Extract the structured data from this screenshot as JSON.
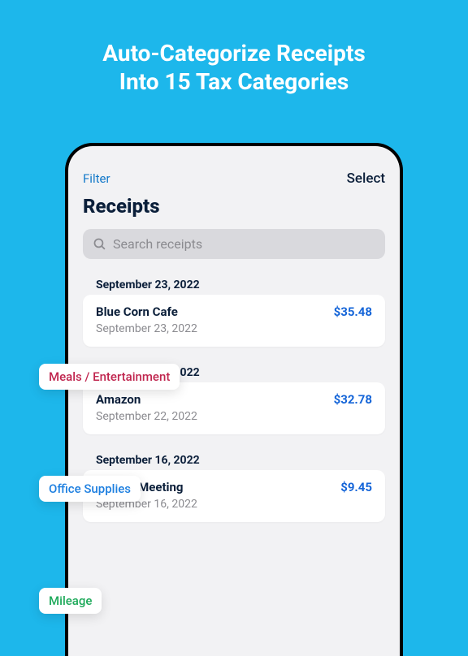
{
  "headline_line1": "Auto-Categorize Receipts",
  "headline_line2": "Into 15 Tax Categories",
  "topbar": {
    "filter": "Filter",
    "select": "Select"
  },
  "page_title": "Receipts",
  "search": {
    "placeholder": "Search receipts"
  },
  "sections": [
    {
      "date_header": "September 23, 2022",
      "card": {
        "merchant": "Blue Corn Cafe",
        "date": "September 23, 2022",
        "amount": "$35.48"
      },
      "tag": {
        "label": "Meals / Entertainment",
        "color": "meals"
      }
    },
    {
      "date_header": "September 22, 2022",
      "card": {
        "merchant": "Amazon",
        "date": "September 22, 2022",
        "amount": "$32.78"
      },
      "tag": {
        "label": "Office Supplies",
        "color": "office"
      }
    },
    {
      "date_header": "September 16, 2022",
      "card": {
        "merchant": "Vendor Meeting",
        "date": "September 16, 2022",
        "amount": "$9.45"
      },
      "tag": {
        "label": "Mileage",
        "color": "mileage"
      }
    }
  ]
}
